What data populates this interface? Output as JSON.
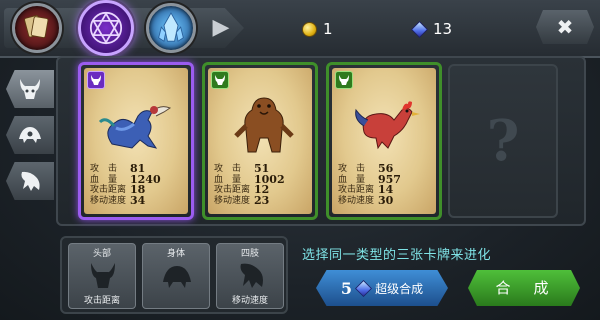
{
  "resources": {
    "coins": "1",
    "gems": "13"
  },
  "close_label": "✖",
  "cards": [
    {
      "rarity": "purple",
      "selected": true,
      "creature": "peacock-warrior",
      "stats": [
        {
          "label": "攻　击",
          "value": "81"
        },
        {
          "label": "血　量",
          "value": "1240"
        },
        {
          "label": "攻击距离",
          "value": "18"
        },
        {
          "label": "移动速度",
          "value": "34"
        }
      ]
    },
    {
      "rarity": "green",
      "selected": false,
      "creature": "bear",
      "stats": [
        {
          "label": "攻　击",
          "value": "51"
        },
        {
          "label": "血　量",
          "value": "1002"
        },
        {
          "label": "攻击距离",
          "value": "12"
        },
        {
          "label": "移动速度",
          "value": "23"
        }
      ]
    },
    {
      "rarity": "green",
      "selected": false,
      "creature": "rooster",
      "stats": [
        {
          "label": "攻　击",
          "value": "56"
        },
        {
          "label": "血　量",
          "value": "957"
        },
        {
          "label": "攻击距离",
          "value": "14"
        },
        {
          "label": "移动速度",
          "value": "30"
        }
      ]
    }
  ],
  "empty_slot": "?",
  "parts": [
    {
      "top": "头部",
      "bottom": "攻击距离",
      "icon": "horned-head-icon"
    },
    {
      "top": "身体",
      "bottom": "",
      "icon": "beast-body-icon"
    },
    {
      "top": "四肢",
      "bottom": "移动速度",
      "icon": "claw-limb-icon"
    }
  ],
  "hint": "选择同一类型的三张卡牌来进化",
  "super_merge": {
    "cost": "5",
    "label": "超级合成"
  },
  "merge_label": "合　成",
  "colors": {
    "purple": "#9b5cf0",
    "green": "#3f8f2a",
    "hint": "#7fe3e6"
  }
}
